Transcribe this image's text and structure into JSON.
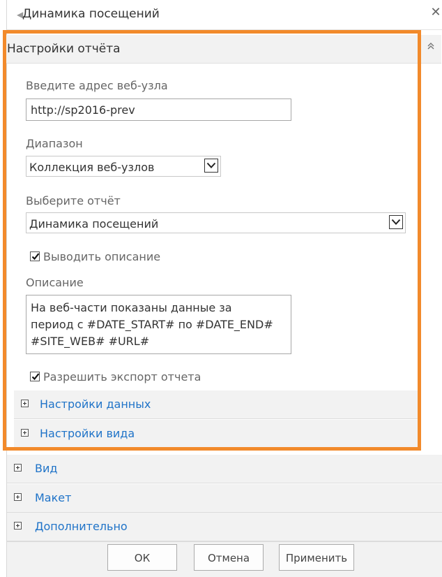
{
  "window": {
    "title": "Динамика посещений",
    "back_icon": "caret-left-icon",
    "close_icon": "close-icon"
  },
  "report_settings": {
    "title": "Настройки отчёта",
    "collapse_icon": "double-chevron-up-icon",
    "site_address": {
      "label": "Введите адрес веб-узла",
      "value": "http://sp2016-prev"
    },
    "range": {
      "label": "Диапазон",
      "selected": "Коллекция веб-узлов"
    },
    "report": {
      "label": "Выберите отчёт",
      "selected": "Динамика посещений"
    },
    "show_description": {
      "label": "Выводить описание",
      "checked": true
    },
    "description": {
      "label": "Описание",
      "value": "На веб-части показаны данные за\nпериод с #DATE_START# по #DATE_END#\n#SITE_WEB# #URL#"
    },
    "allow_export": {
      "label": "Разрешить экспорт отчета",
      "checked": true
    },
    "subsections": [
      {
        "label": "Настройки данных",
        "icon": "plus-box-icon"
      },
      {
        "label": "Настройки вида",
        "icon": "plus-box-icon"
      }
    ]
  },
  "outer_sections": [
    {
      "label": "Вид",
      "icon": "plus-box-icon"
    },
    {
      "label": "Макет",
      "icon": "plus-box-icon"
    },
    {
      "label": "Дополнительно",
      "icon": "plus-box-icon"
    }
  ],
  "footer": {
    "ok_label": "ОК",
    "cancel_label": "Отмена",
    "apply_label": "Применить"
  },
  "colors": {
    "highlight": "#f28a2b",
    "link": "#1f73c8",
    "section_background": "#f2f2f2"
  }
}
